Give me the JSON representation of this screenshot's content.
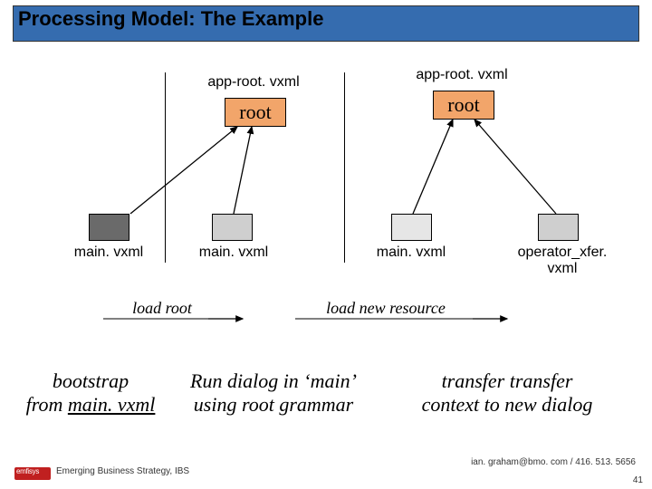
{
  "title": "Processing Model: The Example",
  "col1": {
    "app_root": "app-root. vxml",
    "root": "root",
    "main1": "main. vxml",
    "main2": "main. vxml"
  },
  "col2": {
    "app_root": "app-root. vxml",
    "root": "root",
    "main": "main. vxml",
    "operator": "operator_xfer. vxml"
  },
  "actions": {
    "load_root": "load root",
    "load_new": "load new resource"
  },
  "bottom": {
    "bootstrap1": "bootstrap",
    "bootstrap2_pre": "from ",
    "bootstrap2_u": "main. vxml",
    "run1": "Run dialog in ‘main’",
    "run2": "using root grammar",
    "xfer1": "transfer transfer",
    "xfer2": "context to new dialog"
  },
  "footer": {
    "left": "Emerging Business Strategy, IBS",
    "right": "ian. graham@bmo. com / 416. 513. 5656",
    "page": "41"
  }
}
